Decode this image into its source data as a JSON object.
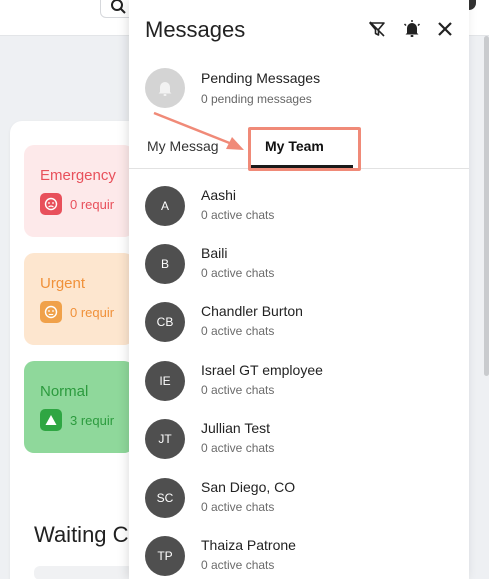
{
  "background": {
    "priorities": [
      {
        "label": "Emergency",
        "count_text": "0 requir"
      },
      {
        "label": "Urgent",
        "count_text": "0 requir"
      },
      {
        "label": "Normal",
        "count_text": "3 requir"
      }
    ],
    "waiting_title": "Waiting C"
  },
  "messages": {
    "title": "Messages",
    "icons": {
      "filter": "filter-off-icon",
      "notify": "bell-alert-icon",
      "close": "close-icon"
    },
    "pending": {
      "title": "Pending Messages",
      "subtitle": "0 pending messages"
    },
    "tabs": {
      "my_messages": "My Messages",
      "my_team": "My Team"
    },
    "team": [
      {
        "initials": "A",
        "name": "Aashi",
        "status": "0 active chats"
      },
      {
        "initials": "B",
        "name": "Baili",
        "status": "0 active chats"
      },
      {
        "initials": "CB",
        "name": "Chandler Burton",
        "status": "0 active chats"
      },
      {
        "initials": "IE",
        "name": "Israel GT employee",
        "status": "0 active chats"
      },
      {
        "initials": "JT",
        "name": "Jullian Test",
        "status": "0 active chats"
      },
      {
        "initials": "SC",
        "name": "San Diego, CO",
        "status": "0 active chats"
      },
      {
        "initials": "TP",
        "name": "Thaiza Patrone",
        "status": "0 active chats"
      }
    ]
  },
  "colors": {
    "emergency": "#e8505b",
    "urgent": "#f0913a",
    "normal": "#2c9b3e",
    "annotation": "#f08a78",
    "avatar": "#4f4f4f"
  }
}
